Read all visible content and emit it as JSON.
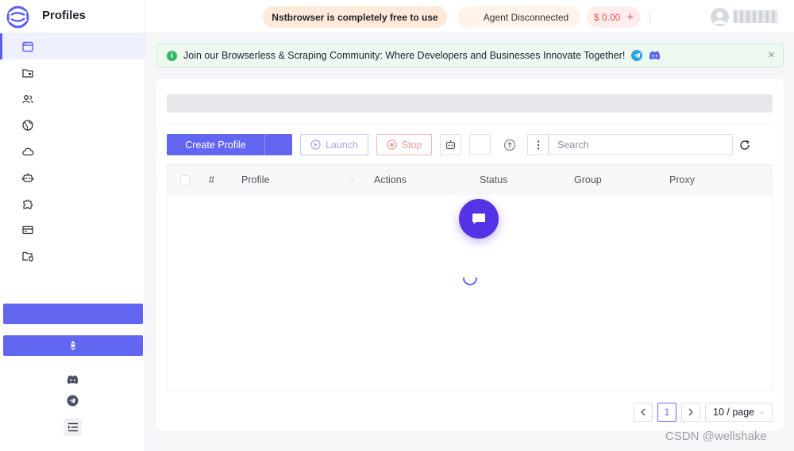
{
  "header": {
    "app_title": "Profiles",
    "promo_text": "Nstbrowser is completely free to use",
    "agent_status": "Agent Disconnected",
    "balance": "$ 0.00",
    "balance_add": "+"
  },
  "sidebar": {
    "items": [
      {
        "icon": "browser-window-icon",
        "active": true
      },
      {
        "icon": "folder-icon",
        "active": false
      },
      {
        "icon": "team-icon",
        "active": false
      },
      {
        "icon": "globe-icon",
        "active": false
      },
      {
        "icon": "cloud-icon",
        "active": false
      },
      {
        "icon": "robot-icon",
        "active": false
      },
      {
        "icon": "extension-icon",
        "active": false
      },
      {
        "icon": "billing-card-icon",
        "active": false
      },
      {
        "icon": "folder-tag-icon",
        "active": false
      }
    ],
    "footer_icons": [
      "rocket-icon",
      "discord-icon",
      "telegram-icon",
      "collapse-menu-icon"
    ]
  },
  "banner": {
    "text": "Join our Browserless & Scraping Community: Where Developers and Businesses Innovate Together!",
    "close": "×"
  },
  "toolbar": {
    "create_label": "Create Profile",
    "launch_label": "Launch",
    "stop_label": "Stop",
    "search_placeholder": "Search"
  },
  "table": {
    "columns": [
      "#",
      "Profile",
      "Actions",
      "Status",
      "Group",
      "Proxy"
    ],
    "rows": []
  },
  "pagination": {
    "current_page": "1",
    "page_size": "10 / page"
  },
  "watermark": "CSDN @wellshake",
  "colors": {
    "accent": "#6366f1",
    "chat_fab": "#5532e6",
    "danger": "#f04e4e",
    "success": "#2fb865"
  }
}
